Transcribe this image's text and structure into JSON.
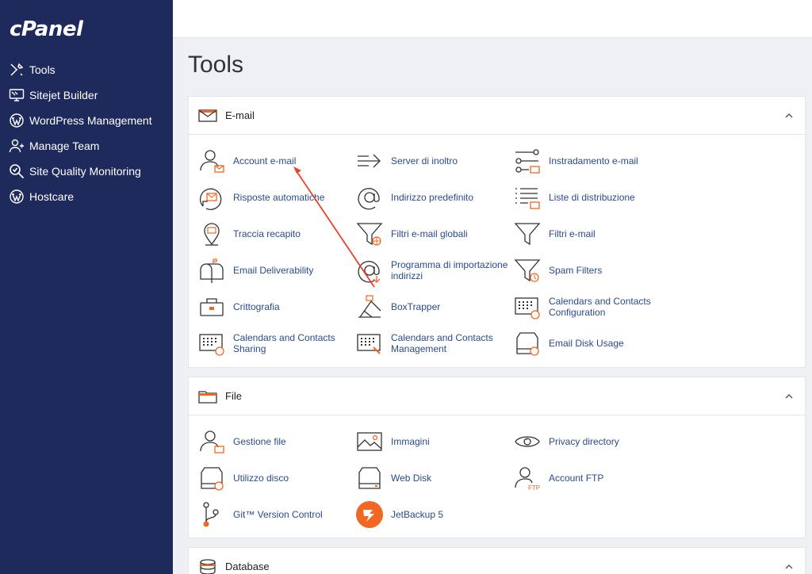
{
  "brand": {
    "logo": "cPanel"
  },
  "sidebar": {
    "items": [
      {
        "label": "Tools",
        "icon": "tools-icon"
      },
      {
        "label": "Sitejet Builder",
        "icon": "monitor-icon"
      },
      {
        "label": "WordPress Management",
        "icon": "wordpress-icon"
      },
      {
        "label": "Manage Team",
        "icon": "team-icon"
      },
      {
        "label": "Site Quality Monitoring",
        "icon": "search-icon"
      },
      {
        "label": "Hostcare",
        "icon": "wordpress-icon"
      }
    ]
  },
  "page": {
    "title": "Tools"
  },
  "colors": {
    "sidebar": "#1f2a5c",
    "accent": "#f26722",
    "link": "#2b4a8a"
  },
  "sections": {
    "email": {
      "title": "E-mail",
      "tools": [
        "Account e-mail",
        "Server di inoltro",
        "Instradamento e-mail",
        "Risposte automatiche",
        "Indirizzo predefinito",
        "Liste di distribuzione",
        "Traccia recapito",
        "Filtri e-mail globali",
        "Filtri e-mail",
        "Email Deliverability",
        "Programma di importazione indirizzi",
        "Spam Filters",
        "Crittografia",
        "BoxTrapper",
        "Calendars and Contacts Configuration",
        "Calendars and Contacts Sharing",
        "Calendars and Contacts Management",
        "Email Disk Usage"
      ]
    },
    "file": {
      "title": "File",
      "tools": [
        "Gestione file",
        "Immagini",
        "Privacy directory",
        "Utilizzo disco",
        "Web Disk",
        "Account FTP",
        "Git™ Version Control",
        "JetBackup 5"
      ]
    },
    "database": {
      "title": "Database"
    }
  }
}
